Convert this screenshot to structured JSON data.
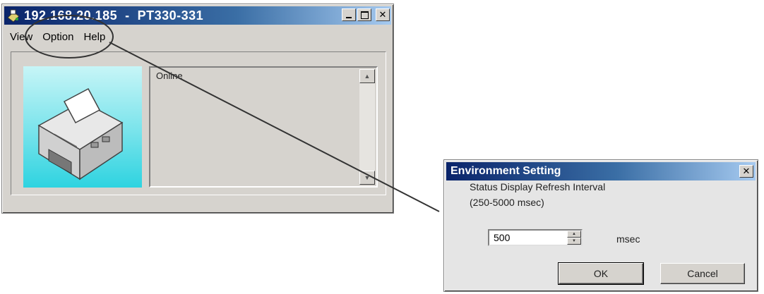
{
  "main_window": {
    "title": "192.168.20.185  -  PT330-331",
    "icon": "app-icon",
    "menu": [
      {
        "label": "View"
      },
      {
        "label": "Option"
      },
      {
        "label": "Help"
      }
    ],
    "status_text": "Online",
    "printer_image": "printer-icon",
    "gradient_colors": [
      "#c7f5f7",
      "#2ed3e0"
    ]
  },
  "dialog": {
    "title": "Environment Setting",
    "label_line1": "Status Display Refresh Interval",
    "label_line2": "(250-5000 msec)",
    "interval_value": "500",
    "unit": "msec",
    "ok_label": "OK",
    "cancel_label": "Cancel"
  },
  "colors": {
    "titlebar_start": "#0a246a",
    "titlebar_end": "#a6caf0",
    "window_face": "#d6d3ce"
  }
}
